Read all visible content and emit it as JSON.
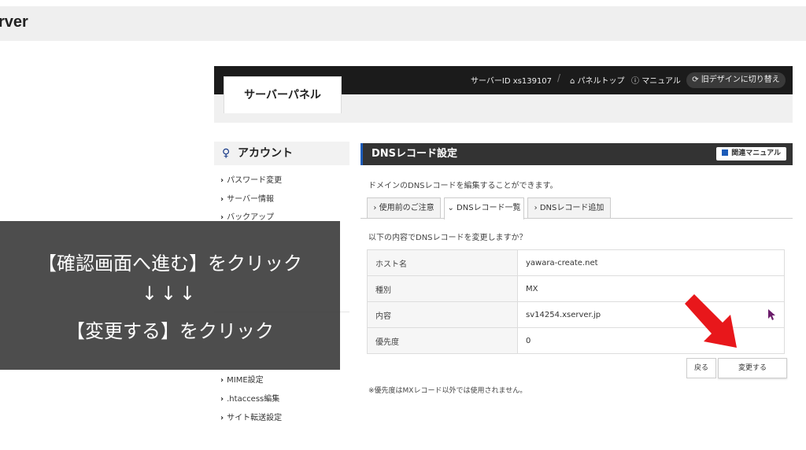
{
  "topbar": {
    "brand": "rver"
  },
  "header": {
    "server_id": "サーバーID xs139107",
    "separator": "/",
    "panel_top": "パネルトップ",
    "manual": "マニュアル",
    "old_design": "旧デザインに切り替え"
  },
  "panel_tab": "サーバーパネル",
  "sidebar": {
    "title": "アカウント",
    "items_top": [
      "パスワード変更",
      "サーバー情報",
      "バックアップ"
    ],
    "items_bottom": [
      "MIME設定",
      ".htaccess編集",
      "サイト転送設定"
    ]
  },
  "main": {
    "title": "DNSレコード設定",
    "manual_button": "関連マニュアル",
    "description": "ドメインのDNSレコードを編集することができます。",
    "tabs": [
      "使用前のご注意",
      "DNSレコード一覧",
      "DNSレコード追加"
    ],
    "confirm_text": "以下の内容でDNSレコードを変更しますか？",
    "rows": [
      {
        "key": "ホスト名",
        "value": "yawara-create.net"
      },
      {
        "key": "種別",
        "value": "MX"
      },
      {
        "key": "内容",
        "value": "sv14254.xserver.jp"
      },
      {
        "key": "優先度",
        "value": "0"
      }
    ],
    "back_button": "戻る",
    "change_button": "変更する",
    "note": "※優先度はMXレコード以外では使用されません。"
  },
  "overlay": {
    "line1": "【確認画面へ進む】をクリック",
    "line2": "↓↓↓",
    "line3": "【変更する】をクリック"
  },
  "colors": {
    "accent": "#1c5bb8",
    "arrow": "#e8171b",
    "cursor": "#6b1d6b"
  }
}
